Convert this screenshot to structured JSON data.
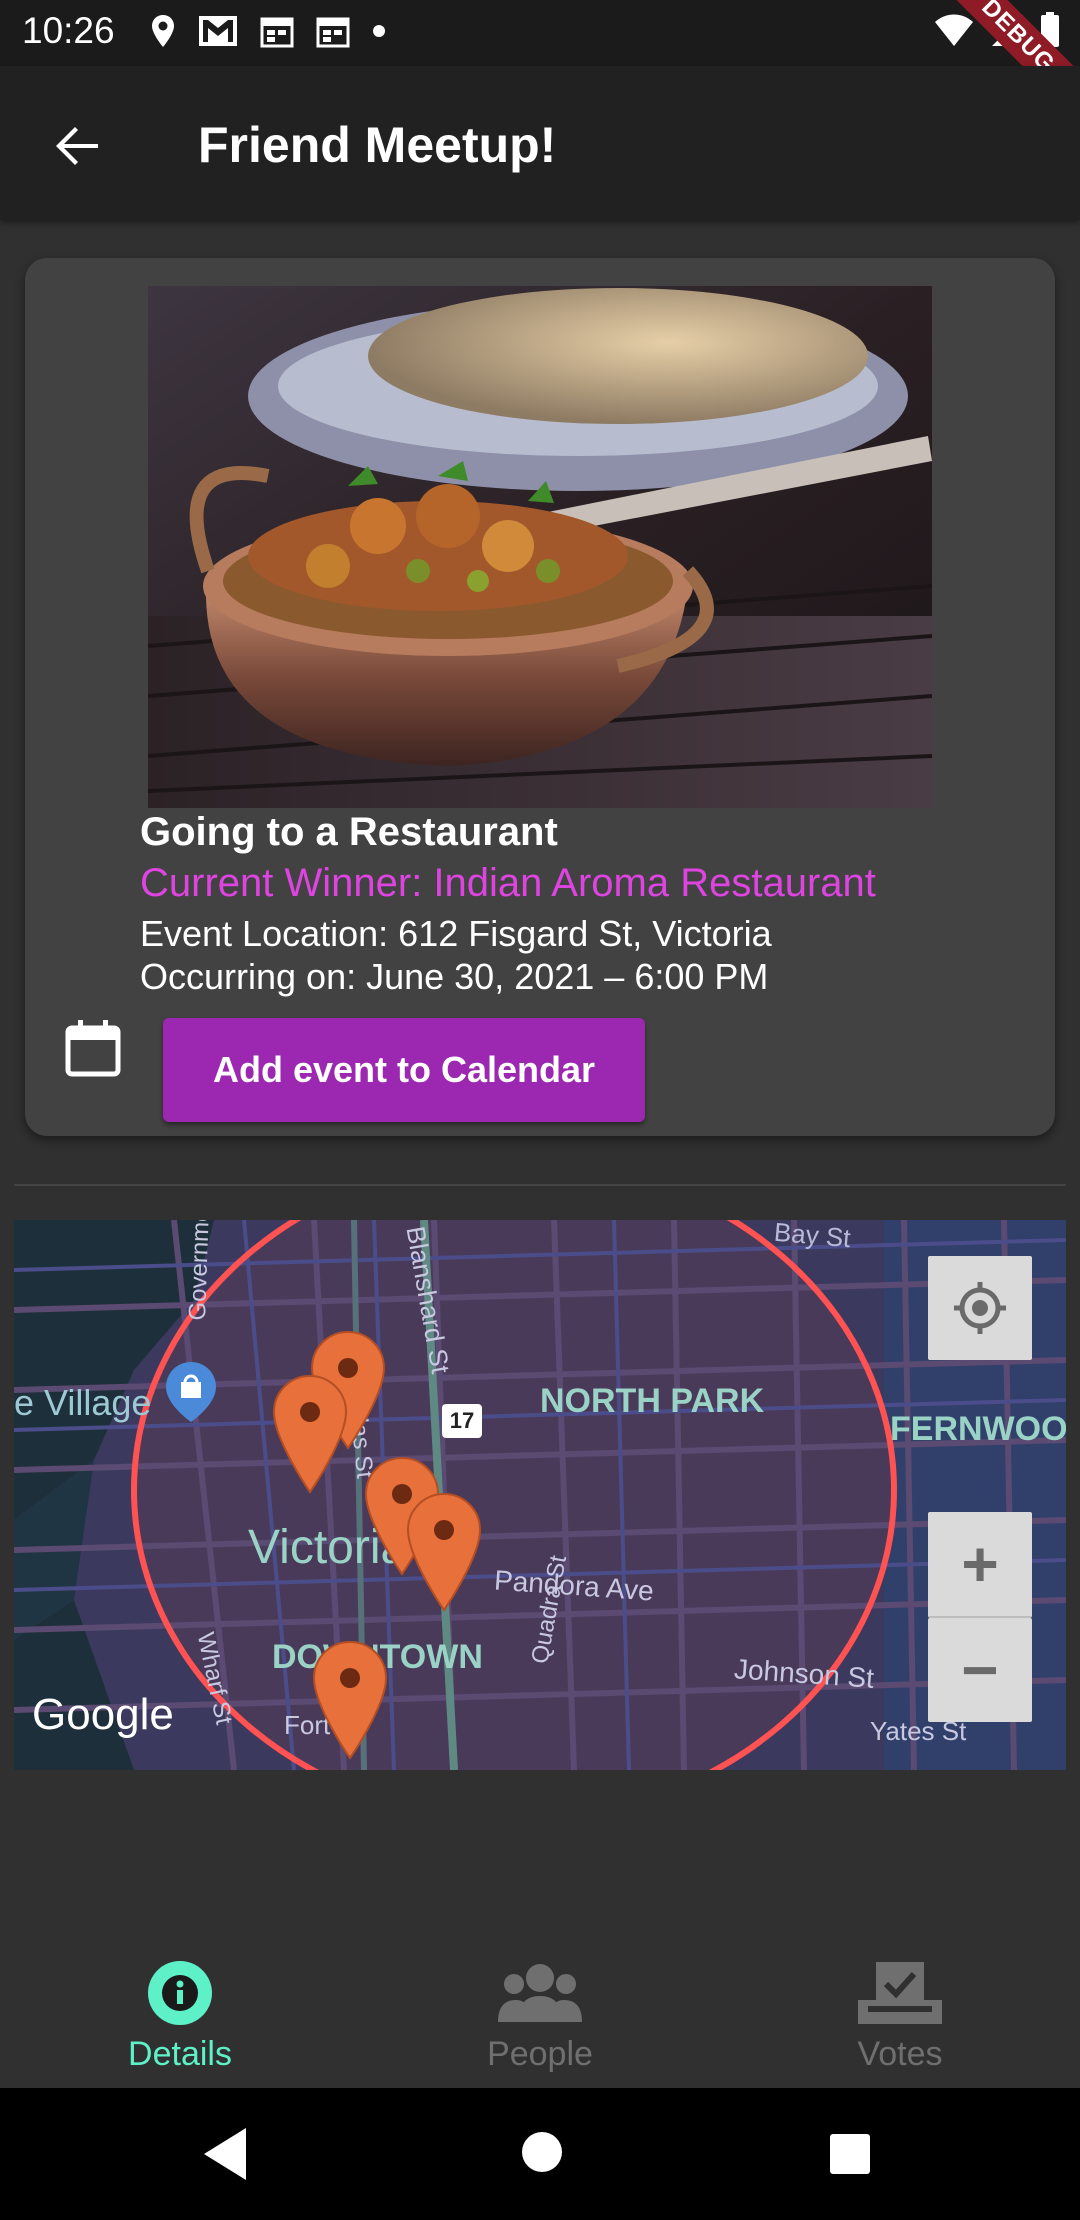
{
  "status_bar": {
    "time": "10:26",
    "icons": [
      "location-icon",
      "gmail-icon",
      "calendar-icon",
      "calendar-icon",
      "dot-icon"
    ],
    "right_icons": [
      "wifi-icon",
      "signal-icon",
      "battery-icon"
    ],
    "debug_label": "DEBUG"
  },
  "app_bar": {
    "title": "Friend Meetup!",
    "back_icon": "arrow-back-icon"
  },
  "event_card": {
    "title": "Going to a Restaurant",
    "winner": "Current Winner: Indian Aroma Restaurant",
    "location": "Event Location: 612 Fisgard St, Victoria",
    "occurring": "Occurring on: June 30, 2021 – 6:00 PM",
    "calendar_icon": "calendar-icon",
    "add_button": "Add event to Calendar"
  },
  "map": {
    "labels": {
      "bay": "Bay St",
      "village": "e Village",
      "government": "Government St",
      "douglas": "Douglas St",
      "blanshard": "Blanshard St",
      "highway": "17",
      "north_park": "NORTH PARK",
      "fernwood": "FERNWOOD",
      "victoria": "Victoria",
      "pandora": "Pandora Ave",
      "downtown": "DOWNTOWN",
      "johnson": "Johnson St",
      "wharf": "Wharf St",
      "fort": "Fort St",
      "quadra": "Quadra St",
      "yates": "Yates St",
      "google": "Google"
    },
    "zoom_in": "+",
    "zoom_out": "−",
    "radius_color": "#ff5252",
    "marker_color": "#e8703a"
  },
  "bottom_nav": {
    "details": "Details",
    "people": "People",
    "votes": "Votes",
    "active_color": "#5ef0c6",
    "inactive_color": "#6f6f6f"
  }
}
